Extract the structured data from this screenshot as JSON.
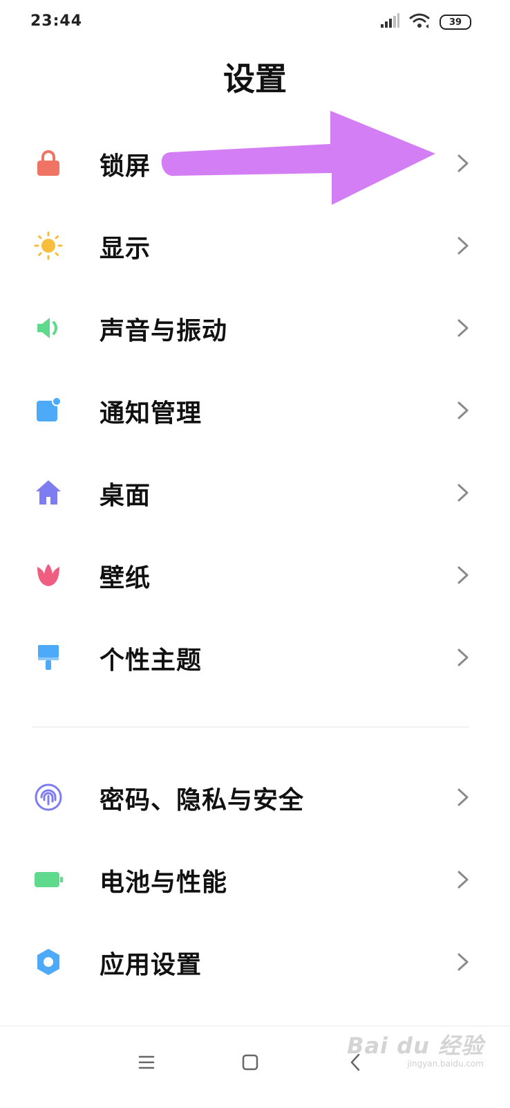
{
  "status_bar": {
    "time": "23:44",
    "battery_level": "39",
    "icons": [
      "signal-icon",
      "wifi-icon",
      "battery-icon"
    ]
  },
  "page": {
    "title": "设置"
  },
  "settings": [
    {
      "label": "锁屏",
      "icon": "lock-icon",
      "icon_color": "#F07464"
    },
    {
      "label": "显示",
      "icon": "sun-icon",
      "icon_color": "#F6BE3A"
    },
    {
      "label": "声音与振动",
      "icon": "speaker-icon",
      "icon_color": "#5FD98C"
    },
    {
      "label": "通知管理",
      "icon": "notification-icon",
      "icon_color": "#4DAAF8"
    },
    {
      "label": "桌面",
      "icon": "home-icon",
      "icon_color": "#7D7CF0"
    },
    {
      "label": "壁纸",
      "icon": "tulip-icon",
      "icon_color": "#EF5E80"
    },
    {
      "label": "个性主题",
      "icon": "paintbrush-icon",
      "icon_color": "#4DAAF8"
    },
    {
      "label": "密码、隐私与安全",
      "icon": "fingerprint-icon",
      "icon_color": "#7D7CF0"
    },
    {
      "label": "电池与性能",
      "icon": "battery-green-icon",
      "icon_color": "#5FD98C"
    },
    {
      "label": "应用设置",
      "icon": "gear-icon",
      "icon_color": "#4DAAF8"
    }
  ],
  "annotation": {
    "arrow_color": "#D47EF5",
    "points_to": "锁屏"
  },
  "nav_bar": {
    "buttons": [
      "menu-icon",
      "home-square-icon",
      "back-icon"
    ]
  },
  "watermark": {
    "main": "Bai du 经验",
    "sub": "jingyan.baidu.com"
  }
}
